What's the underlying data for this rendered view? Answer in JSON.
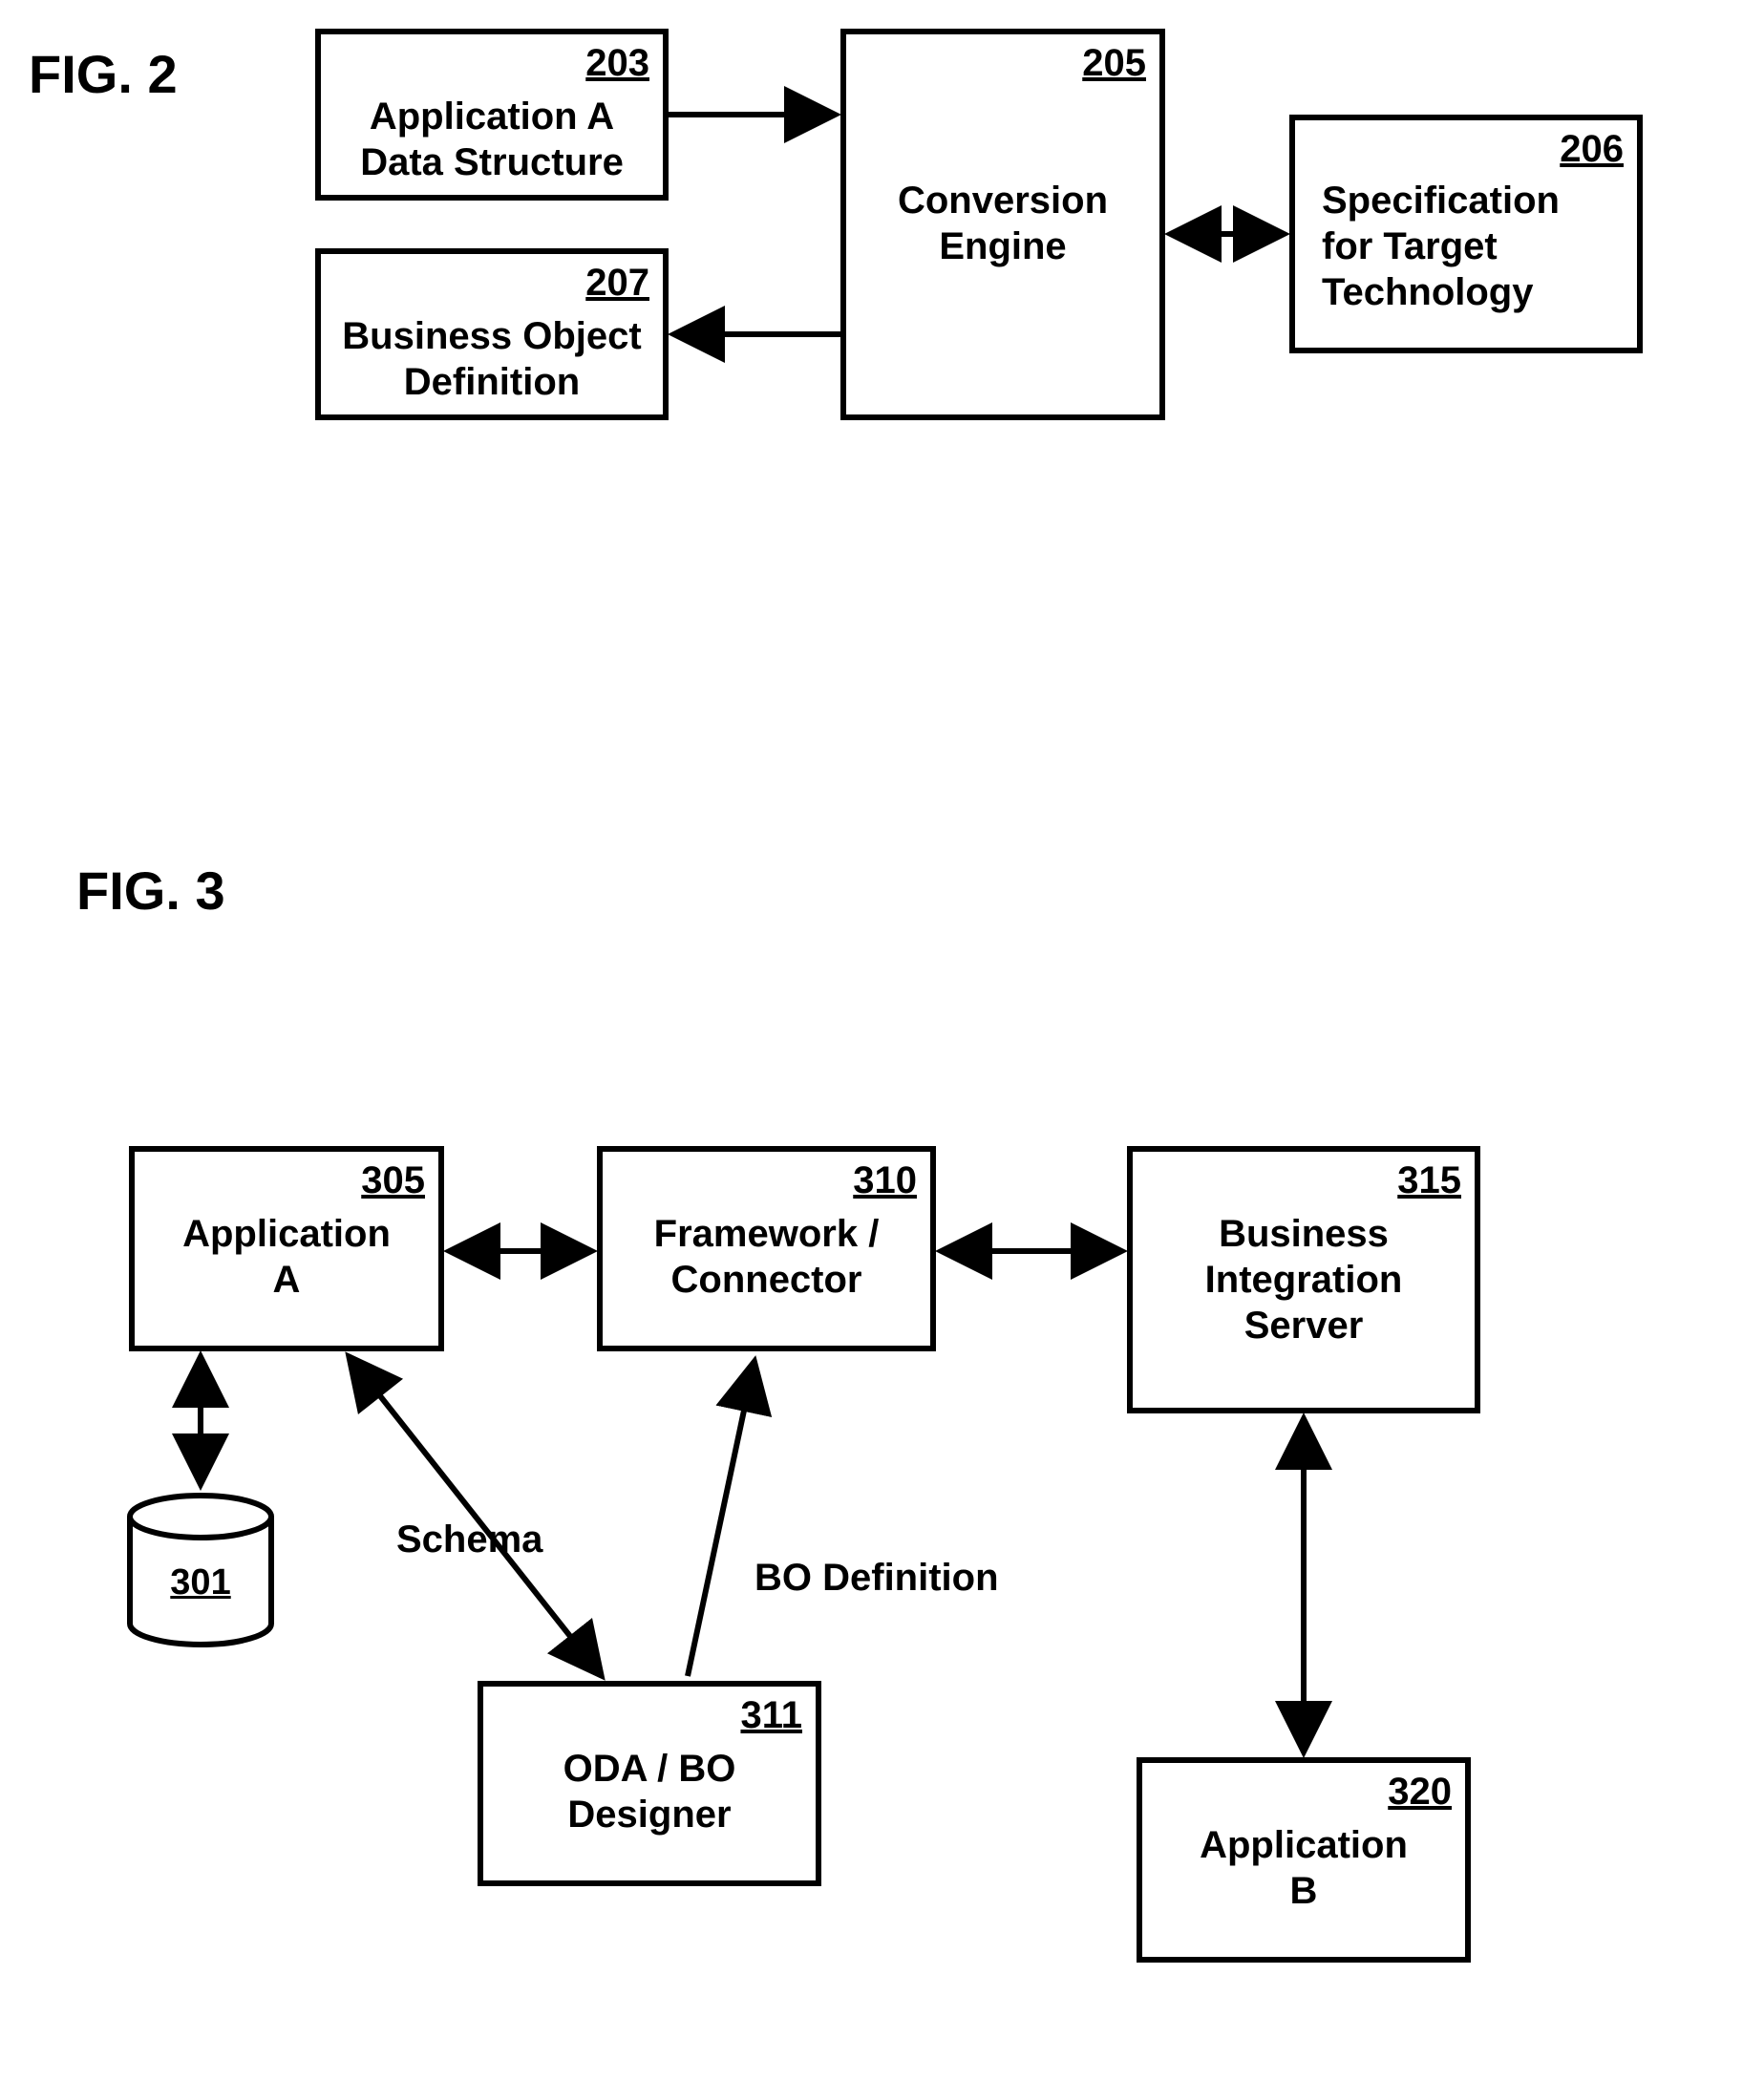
{
  "fig2": {
    "label": "FIG. 2",
    "boxes": {
      "b203": {
        "num": "203",
        "text": "Application A\nData Structure"
      },
      "b205": {
        "num": "205",
        "text": "Conversion\nEngine"
      },
      "b206": {
        "num": "206",
        "text": "Specification\nfor Target\nTechnology"
      },
      "b207": {
        "num": "207",
        "text": "Business Object\nDefinition"
      }
    }
  },
  "fig3": {
    "label": "FIG. 3",
    "boxes": {
      "b305": {
        "num": "305",
        "text": "Application\nA"
      },
      "b310": {
        "num": "310",
        "text": "Framework /\nConnector"
      },
      "b315": {
        "num": "315",
        "text": "Business\nIntegration\nServer"
      },
      "b311": {
        "num": "311",
        "text": "ODA / BO\nDesigner"
      },
      "b320": {
        "num": "320",
        "text": "Application\nB"
      },
      "cyl301": {
        "num": "301"
      }
    },
    "edgeLabels": {
      "schema": "Schema",
      "boDef": "BO Definition"
    }
  }
}
